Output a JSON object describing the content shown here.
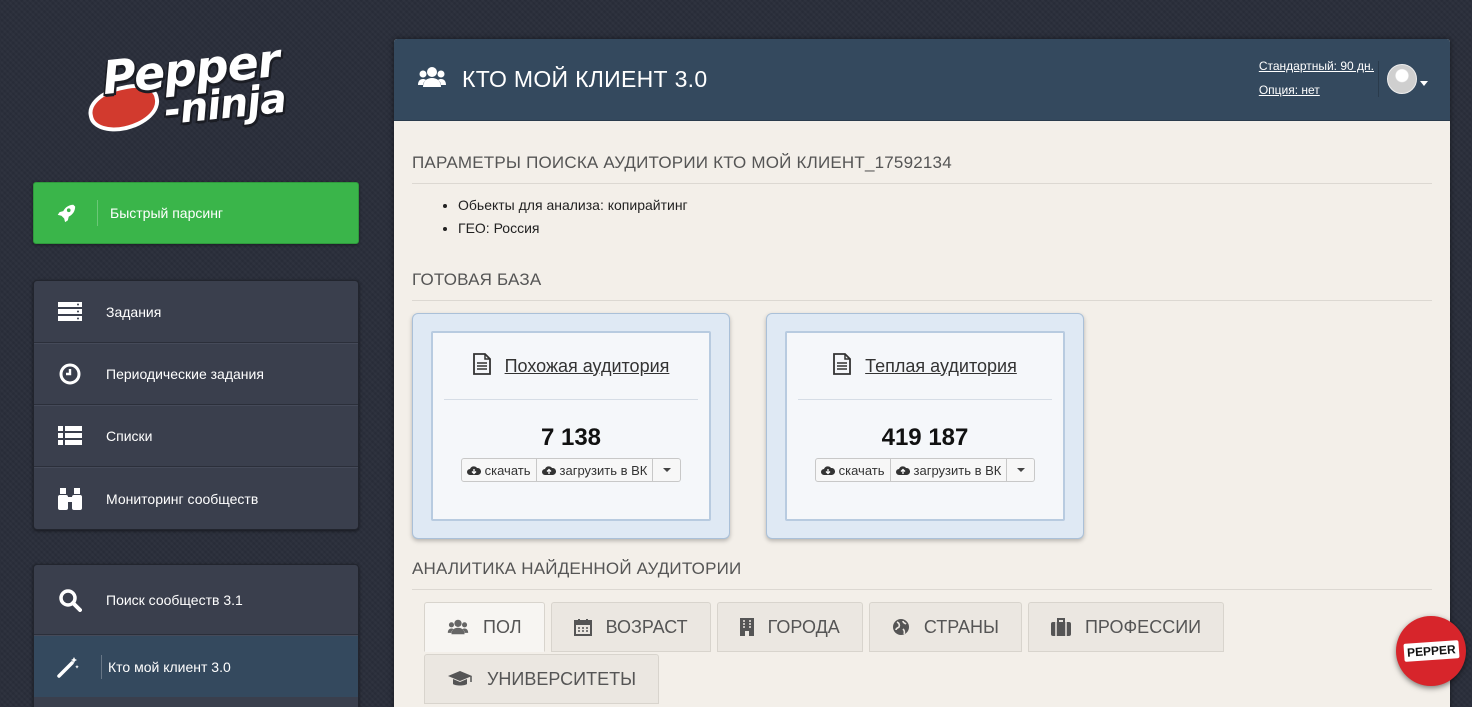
{
  "logo": {
    "line1": "Pepper",
    "line2": "-ninja"
  },
  "sidebar": {
    "quick_parse": {
      "label": "Быстрый парсинг",
      "icon": "rocket-icon"
    },
    "group1": [
      {
        "label": "Задания",
        "icon": "server-icon"
      },
      {
        "label": "Периодические задания",
        "icon": "clock-icon"
      },
      {
        "label": "Списки",
        "icon": "list-icon"
      },
      {
        "label": "Мониторинг сообществ",
        "icon": "binoculars-icon"
      }
    ],
    "group2": [
      {
        "label": "Поиск сообществ 3.1",
        "icon": "search-icon"
      },
      {
        "label": "Кто мой клиент 3.0",
        "icon": "magic-wand-icon",
        "active": true
      }
    ]
  },
  "header": {
    "title": "КТО МОЙ КЛИЕНТ 3.0",
    "plan": "Стандартный: 90 дн.",
    "option": "Опция: нет"
  },
  "params": {
    "title": "ПАРАМЕТРЫ ПОИСКА АУДИТОРИИ КТО МОЙ КЛИЕНТ_17592134",
    "items": [
      "Обьекты для анализа: копирайтинг",
      "ГЕО: Россия"
    ]
  },
  "database": {
    "title": "ГОТОВАЯ БАЗА",
    "cards": [
      {
        "label": "Похожая аудитория",
        "count": "7 138",
        "download": "скачать",
        "upload": "загрузить в ВК"
      },
      {
        "label": "Теплая аудитория",
        "count": "419 187",
        "download": "скачать",
        "upload": "загрузить в ВК"
      }
    ]
  },
  "analytics": {
    "title": "АНАЛИТИКА НАЙДЕННОЙ АУДИТОРИИ",
    "tabs": [
      {
        "label": "ПОЛ",
        "icon": "users-icon",
        "active": true
      },
      {
        "label": "ВОЗРАСТ",
        "icon": "calendar-icon"
      },
      {
        "label": "ГОРОДА",
        "icon": "building-icon"
      },
      {
        "label": "СТРАНЫ",
        "icon": "globe-icon"
      },
      {
        "label": "ПРОФЕССИИ",
        "icon": "briefcase-icon"
      },
      {
        "label": "УНИВЕРСИТЕТЫ",
        "icon": "graduation-cap-icon"
      }
    ]
  },
  "badge": {
    "label": "PEPPER"
  },
  "colors": {
    "accent_green": "#3ab54a",
    "header_blue": "#34495e",
    "panel_bg": "#f3efe9"
  }
}
